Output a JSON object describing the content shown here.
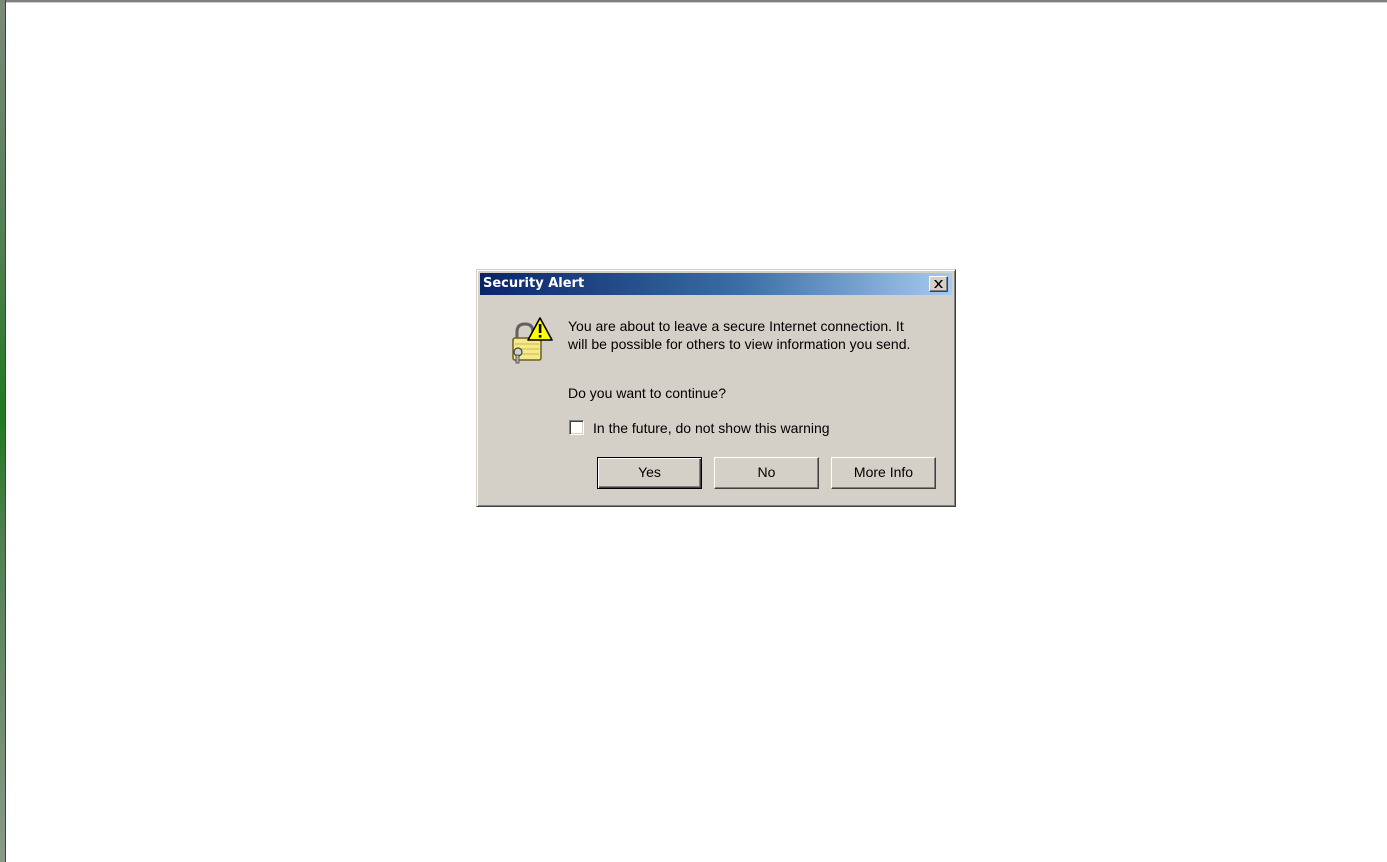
{
  "dialog": {
    "title": "Security Alert",
    "close_icon": "close-icon",
    "alert_icon": "padlock-warning-icon",
    "message_line1": "You are about to leave a secure Internet connection.  It",
    "message_line2": "will be possible for others to view information you send.",
    "question": "Do you want to continue?",
    "checkbox_label": "In the future, do not show this warning",
    "checkbox_checked": false,
    "buttons": {
      "yes": "Yes",
      "no": "No",
      "more_info": "More Info"
    },
    "colors": {
      "title_start": "#0a246a",
      "title_end": "#a6caf0",
      "face": "#d4d0c8"
    }
  }
}
